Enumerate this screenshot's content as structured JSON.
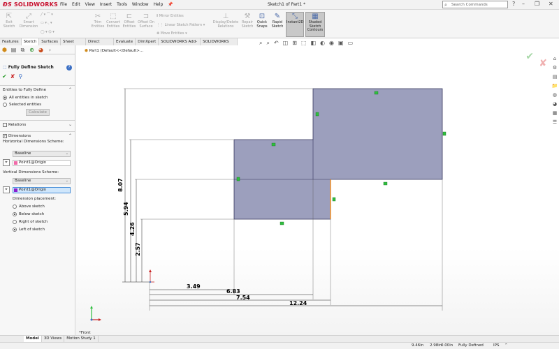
{
  "app": {
    "brand": "SOLIDWORKS",
    "doc_title": "Sketch1 of Part1 *"
  },
  "menu": [
    "File",
    "Edit",
    "View",
    "Insert",
    "Tools",
    "Window",
    "Help"
  ],
  "search": {
    "placeholder": "Search Commands"
  },
  "commands": {
    "exit_sketch": "Exit Sketch",
    "smart_dimension": "Smart Dimension",
    "trim_entities": "Trim Entities",
    "convert_entities": "Convert Entities",
    "offset_entities": "Offset Entities",
    "offset_on_surface": "Offset On Surface",
    "mirror_entities": "Mirror Entities",
    "linear_sketch_pattern": "Linear Sketch Pattern",
    "move_entities": "Move Entities",
    "display_delete_relations": "Display/Delete Relations",
    "repair_sketch": "Repair Sketch",
    "quick_snaps": "Quick Snaps",
    "rapid_sketch": "Rapid Sketch",
    "instant2d": "Instant2D",
    "shaded_sketch_contours": "Shaded Sketch Contours"
  },
  "tabs": [
    "Features",
    "Sketch",
    "Surfaces",
    "Sheet Metal",
    "Direct Editing",
    "Evaluate",
    "DimXpert",
    "SOLIDWORKS Add-Ins",
    "SOLIDWORKS MBD"
  ],
  "active_tab": "Sketch",
  "property_manager": {
    "title": "Fully Define Sketch",
    "entities_group": "Entities to Fully Define",
    "all_entities": "All entities in sketch",
    "selected_entities": "Selected entities",
    "calculate": "Calculate",
    "relations": "Relations",
    "dimensions": "Dimensions",
    "horizontal_scheme_label": "Horizontal Dimensions Scheme:",
    "horizontal_scheme": "Baseline",
    "horizontal_origin": "Point1@Origin",
    "vertical_scheme_label": "Vertical Dimensions Scheme:",
    "vertical_scheme": "Baseline",
    "vertical_origin": "Point1@Origin",
    "placement_label": "Dimension placement:",
    "above": "Above sketch",
    "below": "Below sketch",
    "right": "Right of sketch",
    "left": "Left of sketch"
  },
  "tree_root": "Part1 (Default<<Default>...",
  "view_label": "*Front",
  "dimensions": {
    "vertical": [
      "8.07",
      "5.94",
      "4.26",
      "2.57"
    ],
    "horizontal": [
      "3.49",
      "6.83",
      "7.54",
      "12.24"
    ]
  },
  "bottom_tabs": [
    "Model",
    "3D Views",
    "Motion Study 1"
  ],
  "status": {
    "x": "9.46in",
    "y": "2.98in",
    "z": "0.00in",
    "state": "Fully Defined",
    "units": "IPS"
  },
  "colors": {
    "fill": "#9c9fbd",
    "fill_stroke": "#33335a",
    "accent_red": "#c8102e",
    "relation_green": "#2fbf3f",
    "highlight_orange": "#f08a1c"
  }
}
